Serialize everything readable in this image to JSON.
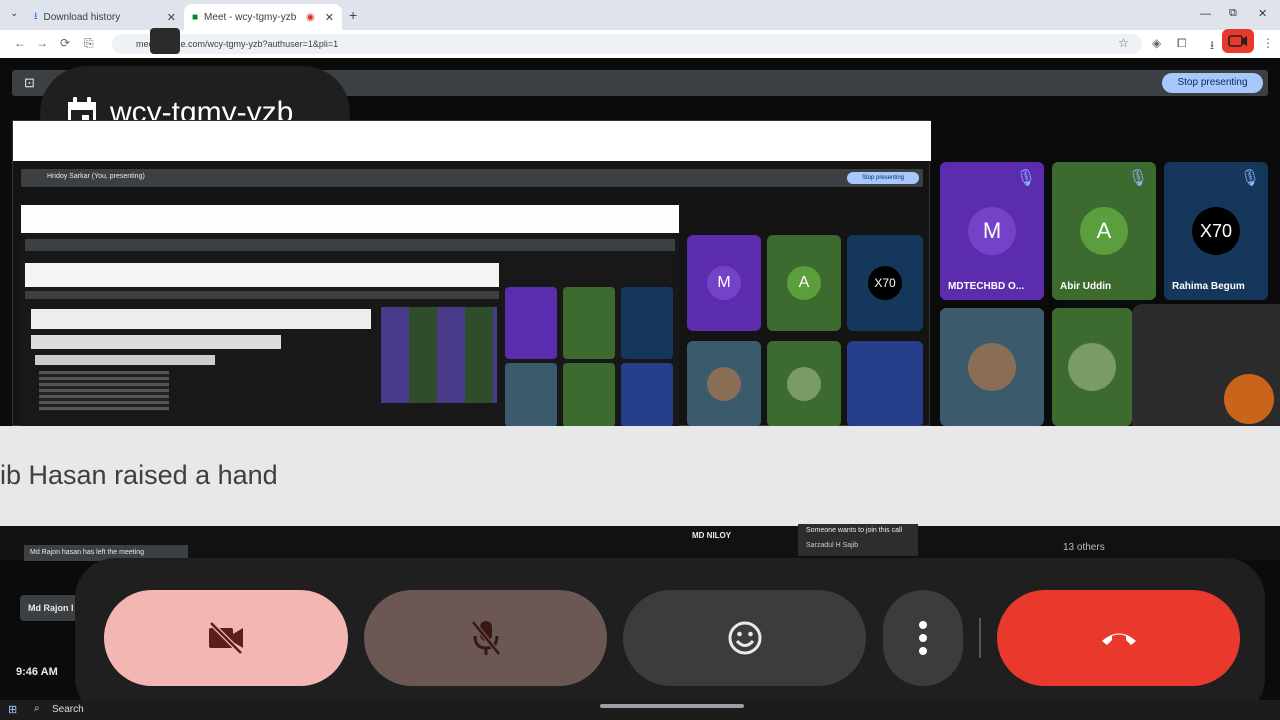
{
  "tabs": [
    {
      "title": "Download history"
    },
    {
      "title": "Meet - wcy-tgmy-yzb"
    }
  ],
  "address": {
    "url": "meet.google.com/wcy-tgmy-yzb?authuser=1&pli=1"
  },
  "presenting": {
    "stop_label": "Stop presenting",
    "inner_title": "Hridoy Sarkar (You, presenting)"
  },
  "meeting": {
    "code": "wcy-tgmy-yzb"
  },
  "participants": [
    {
      "name": "MDTECHBD O...",
      "initial": "M",
      "color": "#5b2cad"
    },
    {
      "name": "Abir Uddin",
      "initial": "A",
      "color": "#3d6b2f"
    },
    {
      "name": "Rahima Begum",
      "initial": "X70",
      "color": "#15375c"
    }
  ],
  "notice": {
    "text": "ib Hasan raised a hand"
  },
  "lower": {
    "left_note": "Md Rajon hasan has left the meeting",
    "join_request": "Someone wants to join this call",
    "join_name": "Sarzadul H Sajib",
    "self_tile": "MD NILOY",
    "others": "13 others",
    "rajon_chip": "Md Rajon I",
    "search": "Search",
    "time": "9:46 AM"
  },
  "controls": {
    "camera": "camera-off",
    "mic": "mic-off",
    "reactions": "emoji",
    "more": "more-options",
    "leave": "end-call"
  },
  "colors": {
    "leave": "#e8392c",
    "camera_bg": "#f4b6b3",
    "mic_bg": "#6b5754"
  }
}
